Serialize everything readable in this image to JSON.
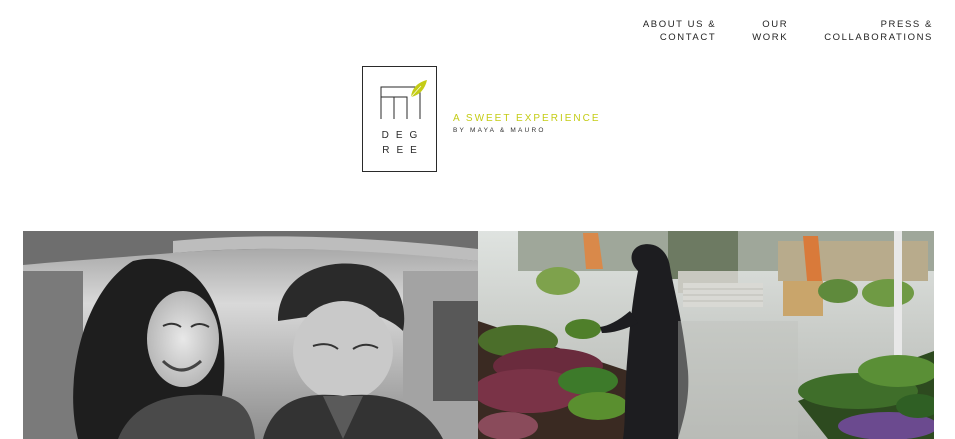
{
  "nav": {
    "items": [
      {
        "line1": "ABOUT US &",
        "line2": "CONTACT"
      },
      {
        "line1": "OUR",
        "line2": "WORK"
      },
      {
        "line1": "PRESS &",
        "line2": "COLLABORATIONS"
      }
    ]
  },
  "logo": {
    "line1": "DEG",
    "line2": "REE",
    "accent_color": "#c4cc16"
  },
  "tagline": {
    "title": "A SWEET EXPERIENCE",
    "subtitle": "BY MAYA & MAURO"
  },
  "photos": [
    {
      "subject": "couple-laughing-market-photo",
      "style": "black-and-white"
    },
    {
      "subject": "farmers-market-stall-photo",
      "style": "color"
    }
  ]
}
